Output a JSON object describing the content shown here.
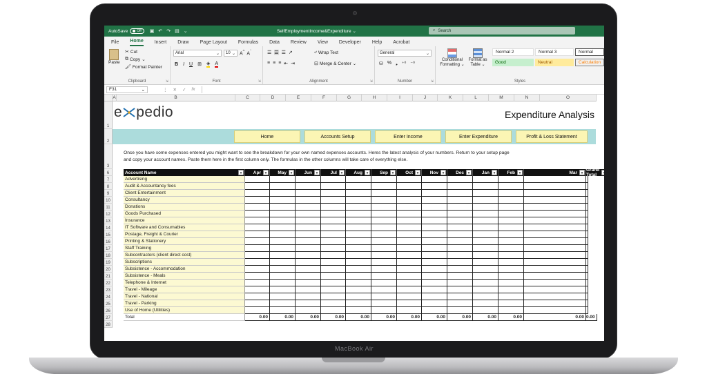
{
  "laptop": {
    "brand": "MacBook Air"
  },
  "titlebar": {
    "autosave_label": "AutoSave",
    "autosave_state": "Off",
    "document_title": "SelfEmploymentIncome&Expenditure",
    "search_placeholder": "Search"
  },
  "tabs": [
    "File",
    "Home",
    "Insert",
    "Draw",
    "Page Layout",
    "Formulas",
    "Data",
    "Review",
    "View",
    "Developer",
    "Help",
    "Acrobat"
  ],
  "ribbon": {
    "clipboard": {
      "paste": "Paste",
      "cut": "Cut",
      "copy": "Copy",
      "format_painter": "Format Painter",
      "label": "Clipboard"
    },
    "font": {
      "name": "Arial",
      "size": "10",
      "label": "Font"
    },
    "alignment": {
      "wrap": "Wrap Text",
      "merge": "Merge & Center",
      "label": "Alignment"
    },
    "number": {
      "format": "General",
      "label": "Number"
    },
    "styles": {
      "conditional": "Conditional",
      "conditional2": "Formatting",
      "format_as": "Format as",
      "format_as2": "Table",
      "normal2": "Normal 2",
      "normal3": "Normal 3",
      "normal": "Normal",
      "good": "Good",
      "neutral": "Neutral",
      "calculation": "Calculation",
      "label": "Styles"
    }
  },
  "formula_bar": {
    "cell_ref": "F31",
    "fx": "fx"
  },
  "columns": [
    "A",
    "B",
    "C",
    "D",
    "E",
    "F",
    "G",
    "H",
    "I",
    "J",
    "K",
    "L",
    "M",
    "N",
    "O"
  ],
  "rows": [
    "1",
    "2",
    "3",
    "6",
    "7",
    "8",
    "9",
    "10",
    "11",
    "12",
    "13",
    "14",
    "15",
    "16",
    "17",
    "18",
    "19",
    "20",
    "21",
    "22",
    "23",
    "24",
    "25",
    "26",
    "27",
    "28"
  ],
  "sheet": {
    "logo_pre": "e",
    "logo_post": "pedio",
    "title": "Expenditure Analysis",
    "nav": [
      "Home",
      "Accounts Setup",
      "Enter Income",
      "Enter Expenditure",
      "Profit & Loss Statement"
    ],
    "intro_line1": "Once you have some expenses entered you might want to see the breakdown for your own named expenses accounts. Heres the latest analysis of your numbers. Return to your setup page",
    "intro_line2": "and copy your account names. Paste them here in the first column only. The formulas in the other columns will take care of everything else.",
    "header_account": "Account Name",
    "months": [
      "Apr",
      "May",
      "Jun",
      "Jul",
      "Aug",
      "Sep",
      "Oct",
      "Nov",
      "Dec",
      "Jan",
      "Feb",
      "Mar",
      "Grand Total"
    ],
    "accounts": [
      "Advertising",
      "Audit & Accountancy fees",
      "Client Entertainment",
      "Consultancy",
      "Donations",
      "Goods Purchased",
      "Insurance",
      "IT Software and Consumables",
      "Postage, Freight & Courier",
      "Printing & Stationery",
      "Staff Training",
      "Subcontractors (client direct cost)",
      "Subscriptions",
      "Subsistence - Accommodation",
      "Subsistence - Meals",
      "Telephone & Internet",
      "Travel - Mileage",
      "Travel - National",
      "Travel - Parking",
      "Use of Home (Utilities)"
    ],
    "total_label": "Total",
    "totals": [
      "0.00",
      "0.00",
      "0.00",
      "0.00",
      "0.00",
      "0.00",
      "0.00",
      "0.00",
      "0.00",
      "0.00",
      "0.00",
      "0.00",
      "0.00"
    ]
  }
}
